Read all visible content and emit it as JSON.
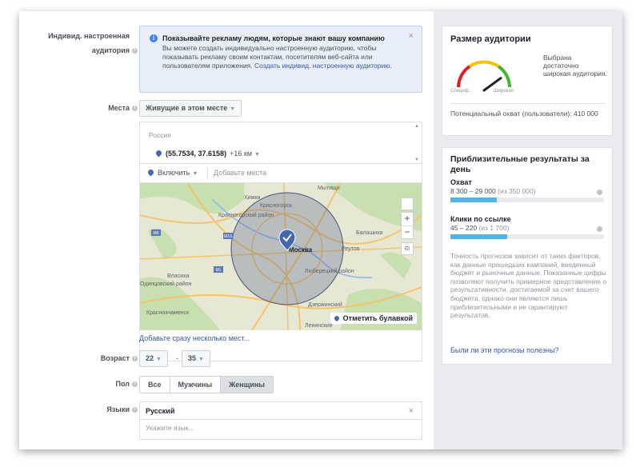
{
  "custom_audience": {
    "label": "Индивид. настроенная аудитория",
    "notice": {
      "title": "Показывайте рекламу людям, которые знают вашу компанию",
      "body": "Вы можете создать индивидуально настроенную аудиторию, чтобы показывать рекламу своим контактам, посетителям веб-сайта или пользователям приложения.",
      "link": "Создать индивид. настроенную аудиторию.",
      "close": "×"
    }
  },
  "locations": {
    "label": "Места",
    "type_select": "Живущие в этом месте",
    "country": "Россия",
    "point": "(55.7534, 37.6158)",
    "radius": "+16 км",
    "include_select": "Включить",
    "add_places_placeholder": "Добавьте места",
    "map": {
      "center_label": "Москва",
      "place_labels": [
        "Химки",
        "Мытищи",
        "Красногорский район",
        "Балашиха",
        "Реутов",
        "Люберецкий район",
        "Одинцовский район",
        "Власиха",
        "Дзержинский",
        "Красногорск",
        "Ленинский",
        "Краснознаменск"
      ],
      "road_shields": [
        "M9",
        "M10",
        "M1"
      ],
      "drop_pin": "Отметить булавкой",
      "zoom_in": "+",
      "zoom_out": "−"
    },
    "bulk_link": "Добавьте сразу несколько мест..."
  },
  "age": {
    "label": "Возраст",
    "min": "22",
    "max": "35",
    "separator": "-"
  },
  "gender": {
    "label": "Пол",
    "options": [
      "Все",
      "Мужчины",
      "Женщины"
    ],
    "selected": "Женщины"
  },
  "languages": {
    "label": "Языки",
    "selected": "Русский",
    "placeholder": "Укажите язык...",
    "remove": "×"
  },
  "audience_size": {
    "title": "Размер аудитории",
    "gauge_left": "Специф...",
    "gauge_right": "Широкая",
    "status": "Выбрана достаточно широкая аудитория.",
    "potential_reach": "Потенциальный охват (пользователи): 410 000",
    "gauge_level": 0.8
  },
  "daily_results": {
    "title": "Приблизительные результаты за день",
    "reach": {
      "label": "Охват",
      "value": "8 300 – 29 000",
      "total": "(из 350 000)",
      "fill": 0.3
    },
    "clicks": {
      "label": "Клики по ссылке",
      "value": "45 – 220",
      "total": "(из 1 700)",
      "fill": 0.37
    },
    "disclaimer": "Точность прогнозов зависит от таких факторов, как данные прошедших кампаний, введенный бюджет и рыночные данные. Показанные цифры позволяют получить примерное представление о результативности, достигаемой за счет вашего бюджета, однако они являются лишь приблизительными и не гарантируют результатов.",
    "feedback_link": "Были ли эти прогнозы полезны?"
  },
  "colors": {
    "accent": "#4267b2",
    "link": "#365899",
    "notice_bg": "#e9effa",
    "bar_fill": "#4db6e6",
    "sidebar_bg": "#e9ebee"
  }
}
